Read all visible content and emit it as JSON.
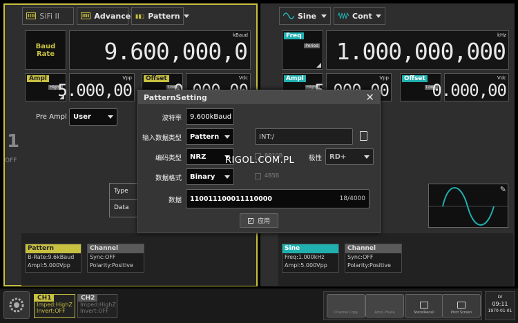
{
  "ch1": {
    "tab_sifi": "SiFi II",
    "tab_advanced": "Advanced",
    "tab_pattern": "Pattern",
    "baud_label_1": "Baud",
    "baud_label_2": "Rate",
    "baud_unit": "kBaud",
    "baud_value": "9.600,000,0",
    "ampl_tag": "Ampl",
    "ampl_sub": "HighL",
    "ampl_unit": "Vpp",
    "ampl_value": "5.000,00",
    "offset_tag": "Offset",
    "offset_sub": "LowL",
    "offset_unit": "Vdc",
    "offset_value": "0.000,00",
    "pre_ampl_label": "Pre Ampl",
    "pre_ampl_value": "User",
    "type_label": "Type",
    "data_label": "Data",
    "number": "1",
    "state": "OFF",
    "card1": {
      "title": "Pattern",
      "line1": "B-Rate:9.6kBaud",
      "line2": "Ampl:5.000Vpp"
    },
    "card2": {
      "title": "Channel",
      "line1": "Sync:OFF",
      "line2": "Polarity:Positive"
    }
  },
  "ch2": {
    "tab_wave": "Sine",
    "tab_mod": "Cont",
    "freq_tag": "Freq",
    "freq_sub": "Period",
    "freq_unit": "kHz",
    "freq_value": "1.000,000,000",
    "ampl_tag": "Ampl",
    "ampl_sub": "HighL",
    "ampl_unit": "Vpp",
    "ampl_value": "5.000,00",
    "offset_tag": "Offset",
    "offset_sub": "LowL",
    "offset_unit": "Vdc",
    "offset_value": "0.000,00",
    "card1": {
      "title": "Sine",
      "line1": "Freq:1.000kHz",
      "line2": "Ampl:5.000Vpp"
    },
    "card2": {
      "title": "Channel",
      "line1": "Sync:OFF",
      "line2": "Polarity:Positive"
    }
  },
  "dialog": {
    "title": "PatternSetting",
    "baud_label": "波特率",
    "baud_value": "9.600kBaud",
    "input_type_label": "输入数据类型",
    "input_type_value": "Pattern",
    "path_value": "INT:/",
    "encoding_label": "编码类型",
    "encoding_value": "NRZ",
    "opt_8b10b": "8B10B",
    "polarity_label": "极性",
    "polarity_value": "RD+",
    "format_label": "数据格式",
    "format_value": "Binary",
    "opt_4b5b": "4B5B",
    "data_label": "数据",
    "data_value": "110011100011110000",
    "data_count": "18/4000",
    "apply_label": "应用"
  },
  "watermark": "RIGOL.COM.PL",
  "bottom": {
    "ch1_tab": "CH1",
    "ch1_line1": "Imped:HighZ",
    "ch1_line2": "Invert:OFF",
    "ch2_tab": "CH2",
    "ch2_line1": "Imped:HighZ",
    "ch2_line2": "Invert:OFF",
    "btn_channel_copy": "Channel Copy",
    "btn_ampl_phase": "Ampl Phase",
    "btn_store_recall": "Store/Recall",
    "btn_print_screen": "Print Screen",
    "lv": "LV",
    "time": "09:11",
    "date": "1970-01-01"
  },
  "colors": {
    "ch1_accent": "#d8d040",
    "ch2_accent": "#20b0b0",
    "dialog_header": "#4a4a4a"
  }
}
